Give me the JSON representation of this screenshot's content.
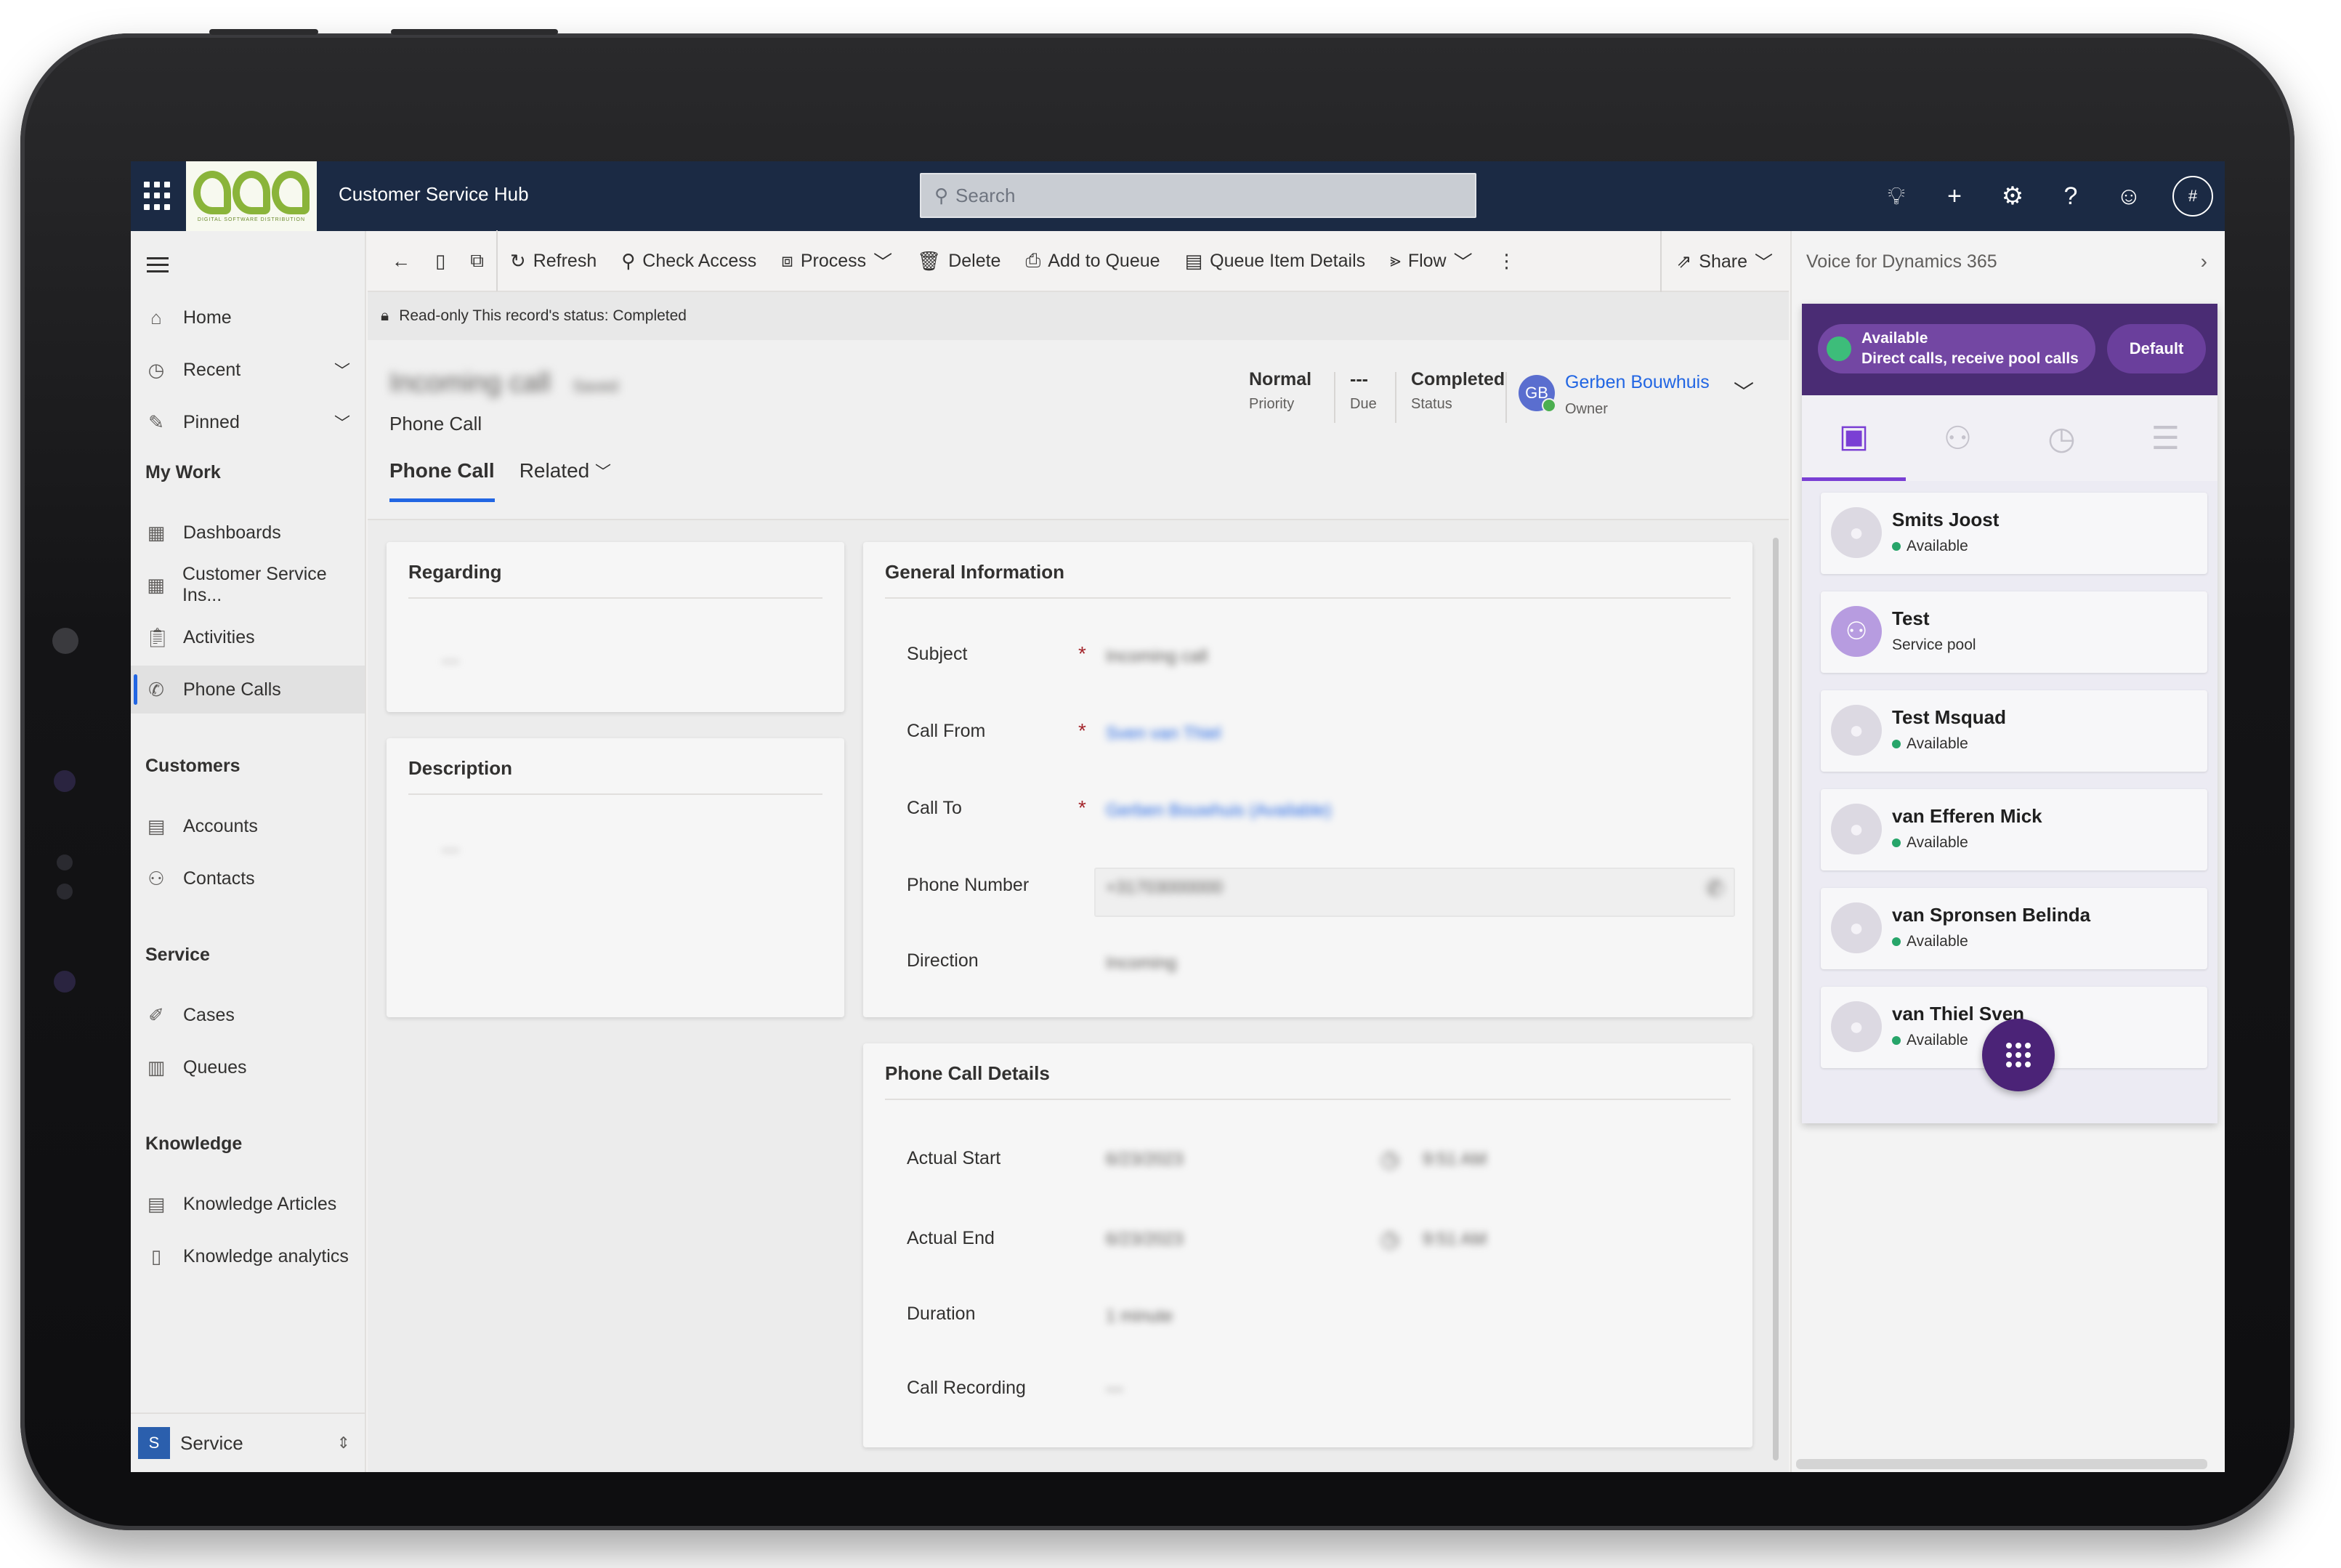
{
  "topbar": {
    "logo_text": "DIGITAL SOFTWARE DISTRIBUTION",
    "app_title": "Customer Service Hub",
    "search_placeholder": "Search",
    "avatar_initial": "#"
  },
  "sidebar": {
    "items_top": [
      {
        "label": "Home",
        "icon": "home-icon"
      },
      {
        "label": "Recent",
        "icon": "clock-icon"
      },
      {
        "label": "Pinned",
        "icon": "pin-icon"
      }
    ],
    "groups": {
      "my_work": "My Work",
      "customers": "Customers",
      "service": "Service",
      "knowledge": "Knowledge"
    },
    "my_work_items": [
      "Dashboards",
      "Customer Service Ins...",
      "Activities",
      "Phone Calls"
    ],
    "customer_items": [
      "Accounts",
      "Contacts"
    ],
    "service_items": [
      "Cases",
      "Queues"
    ],
    "knowledge_items": [
      "Knowledge Articles",
      "Knowledge analytics"
    ],
    "area": {
      "initial": "S",
      "label": "Service"
    }
  },
  "commandbar": {
    "refresh": "Refresh",
    "check_access": "Check Access",
    "process": "Process",
    "delete": "Delete",
    "add_to_queue": "Add to Queue",
    "queue_item_details": "Queue Item Details",
    "flow": "Flow",
    "share": "Share"
  },
  "banner": {
    "text": "Read-only This record's status: Completed"
  },
  "header": {
    "record_title": "Incoming call",
    "record_title_suffix": "Saved",
    "record_type": "Phone Call",
    "priority_value": "Normal",
    "priority_label": "Priority",
    "due_value": "---",
    "due_label": "Due",
    "status_value": "Completed",
    "status_label": "Status",
    "owner_initials": "GB",
    "owner_name": "Gerben Bouwhuis",
    "owner_label": "Owner",
    "tabs": [
      "Phone Call",
      "Related"
    ]
  },
  "form": {
    "regarding": {
      "title": "Regarding",
      "value": "---"
    },
    "description": {
      "title": "Description",
      "value": "---"
    },
    "general": {
      "title": "General Information",
      "subject_label": "Subject",
      "subject_value": "Incoming call",
      "call_from_label": "Call From",
      "call_from_value": "Sven van Thiel",
      "call_to_label": "Call To",
      "call_to_value": "Gerben Bouwhuis (Available)",
      "phone_label": "Phone Number",
      "phone_value": "+31703000000",
      "direction_label": "Direction",
      "direction_value": "Incoming"
    },
    "details": {
      "title": "Phone Call Details",
      "actual_start_label": "Actual Start",
      "actual_start_date": "6/23/2023",
      "actual_start_time": "9:51 AM",
      "actual_end_label": "Actual End",
      "actual_end_date": "6/23/2023",
      "actual_end_time": "9:51 AM",
      "duration_label": "Duration",
      "duration_value": "1 minute",
      "recording_label": "Call Recording",
      "recording_value": "---"
    }
  },
  "voice_panel": {
    "title": "Voice for Dynamics 365",
    "status_line1": "Available",
    "status_line2": "Direct calls, receive pool calls",
    "default_label": "Default",
    "contacts": [
      {
        "name": "Smits Joost",
        "status": "Available",
        "pool": false
      },
      {
        "name": "Test",
        "status": "Service pool",
        "pool": true
      },
      {
        "name": "Test Msquad",
        "status": "Available",
        "pool": false
      },
      {
        "name": "van Efferen Mick",
        "status": "Available",
        "pool": false
      },
      {
        "name": "van Spronsen Belinda",
        "status": "Available",
        "pool": false
      },
      {
        "name": "van Thiel Sven",
        "status": "Available",
        "pool": false
      }
    ]
  }
}
